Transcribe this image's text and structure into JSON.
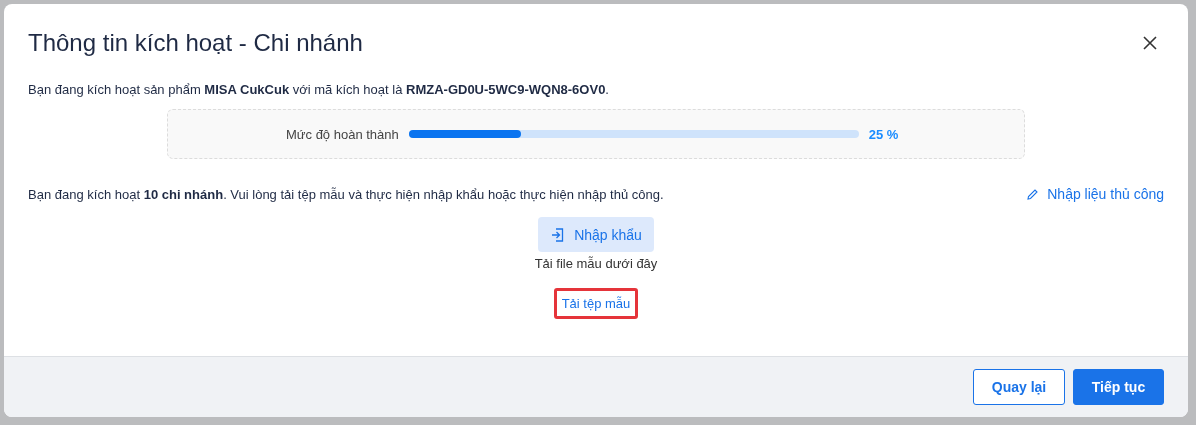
{
  "dialog": {
    "title": "Thông tin kích hoạt - Chi nhánh"
  },
  "intro": "Bạn đang kích hoạt sản phẩm **MISA CukCuk** với mã kích hoạt là **RMZA-GD0U-5WC9-WQN8-6OV0**.",
  "progress": {
    "label": "Mức độ hoàn thành",
    "level": 0.25,
    "reading": "25 %"
  },
  "instruction": "Bạn đang kích hoạt **10 chi nhánh**. Vui lòng tải tệp mẫu và thực hiện nhập khẩu hoặc thực hiện nhập thủ công.",
  "manual_link": "Nhập liệu thủ công",
  "import_button": "Nhập khẩu",
  "import_hint": "Tải file mẫu dưới đây",
  "template_link": {
    "label": "Tải tệp mẫu",
    "highlighted": true
  },
  "buttons": [
    {
      "label": "Quay lại",
      "kind": "secondary"
    },
    {
      "label": "Tiếp tục",
      "kind": "primary"
    }
  ]
}
